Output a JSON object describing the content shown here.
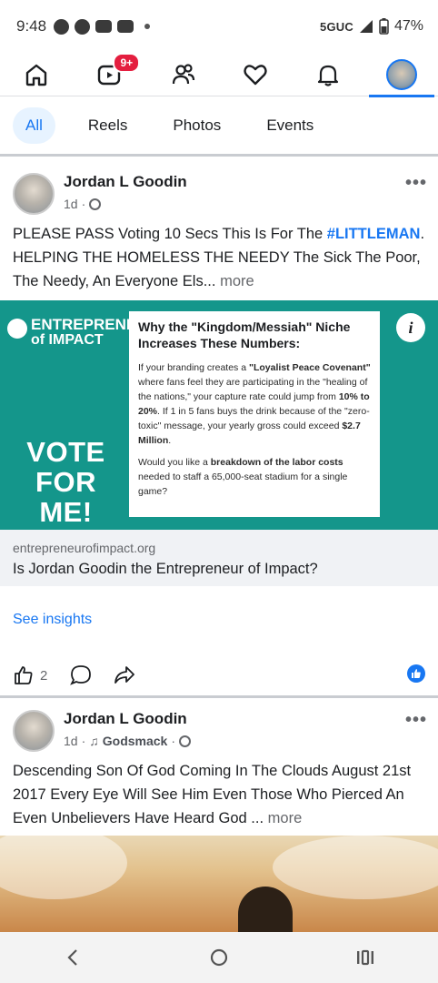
{
  "status_bar": {
    "time": "9:48",
    "network": "5GUC",
    "battery": "47%"
  },
  "top_nav": {
    "items": [
      {
        "name": "home-icon"
      },
      {
        "name": "video-icon",
        "badge": "9+"
      },
      {
        "name": "friends-icon"
      },
      {
        "name": "dating-heart-icon"
      },
      {
        "name": "notifications-bell-icon"
      },
      {
        "name": "profile-avatar",
        "active": true
      }
    ]
  },
  "filters": {
    "tabs": [
      "All",
      "Reels",
      "Photos",
      "Events"
    ],
    "active": "All"
  },
  "post1": {
    "author": "Jordan L Goodin",
    "time": "1d",
    "text_before_tag": "PLEASE PASS Voting 10 Secs This Is For The ",
    "hashtag": "#LITTLEMAN",
    "text_after_tag": ". HELPING THE HOMELESS THE NEEDY The Sick The Poor, The Needy, An Everyone Els...",
    "more": " more",
    "ad": {
      "brand_line1": "ENTREPRENEUR",
      "brand_line2": "of IMPACT",
      "vote": "VOTE FOR ME!",
      "heading": "Why the \"Kingdom/Messiah\" Niche Increases These Numbers:",
      "p1_a": "If your branding creates a ",
      "p1_b": "\"Loyalist Peace Covenant\"",
      "p1_c": " where fans feel they are participating in the \"healing of the nations,\" your capture rate could jump from ",
      "p1_d": "10% to 20%",
      "p1_e": ". If 1 in 5 fans buys the drink because of the \"zero-toxic\" message, your yearly gross could exceed ",
      "p1_f": "$2.7 Million",
      "p1_g": ".",
      "p2_a": "Would you like a ",
      "p2_b": "breakdown of the labor costs",
      "p2_c": " needed to staff a 65,000-seat stadium for a single game?"
    },
    "link_domain": "entrepreneurofimpact.org",
    "link_title": "Is Jordan Goodin the Entrepreneur of Impact?",
    "insights": "See insights",
    "like_count": "2"
  },
  "post2": {
    "author": "Jordan L Goodin",
    "time": "1d",
    "music": "Godsmack",
    "text": "Descending Son Of God Coming In The Clouds August 21st 2017 Every Eye Will See Him Even Those Who Pierced An Even Unbelievers Have Heard God ...",
    "more": " more"
  }
}
